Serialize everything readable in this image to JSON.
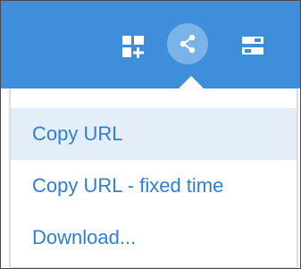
{
  "toolbar": {
    "icons": [
      "add-panel-icon",
      "share-icon",
      "settings-icon"
    ],
    "background_color": "#3f8edc",
    "active_icon_bg": "#7bb3e8"
  },
  "share_menu": {
    "items": [
      {
        "label": "Copy URL",
        "highlighted": true
      },
      {
        "label": "Copy URL - fixed time",
        "highlighted": false
      },
      {
        "label": "Download...",
        "highlighted": false
      }
    ],
    "text_color": "#2f7fd0",
    "highlight_color": "#e3eef9"
  }
}
